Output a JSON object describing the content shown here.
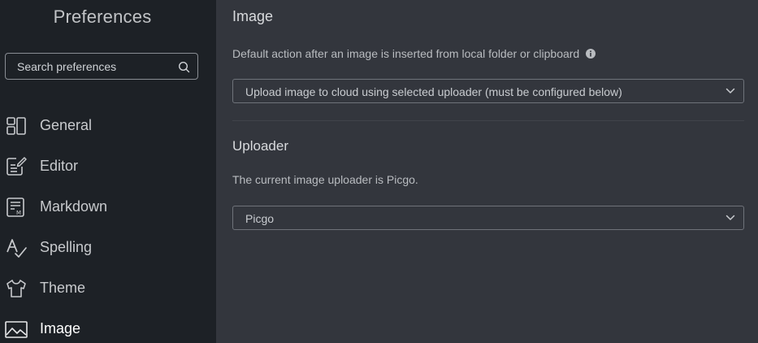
{
  "sidebar": {
    "title": "Preferences",
    "search": {
      "placeholder": "Search preferences",
      "value": ""
    },
    "items": [
      {
        "label": "General",
        "icon": "layout-grid-icon",
        "active": false
      },
      {
        "label": "Editor",
        "icon": "edit-note-icon",
        "active": false
      },
      {
        "label": "Markdown",
        "icon": "markdown-doc-icon",
        "active": false
      },
      {
        "label": "Spelling",
        "icon": "spellcheck-icon",
        "active": false
      },
      {
        "label": "Theme",
        "icon": "shirt-icon",
        "active": false
      },
      {
        "label": "Image",
        "icon": "image-icon",
        "active": true
      }
    ]
  },
  "main": {
    "image_section": {
      "title": "Image",
      "description": "Default action after an image is inserted from local folder or clipboard",
      "info_icon": "info-icon",
      "select_value": "Upload image to cloud using selected uploader (must be configured below)"
    },
    "uploader_section": {
      "title": "Uploader",
      "description": "The current image uploader is Picgo.",
      "select_value": "Picgo"
    }
  },
  "colors": {
    "sidebar_bg": "#1d2126",
    "main_bg": "#33363d",
    "text_primary": "#d8dadd",
    "border": "#6f737a"
  }
}
